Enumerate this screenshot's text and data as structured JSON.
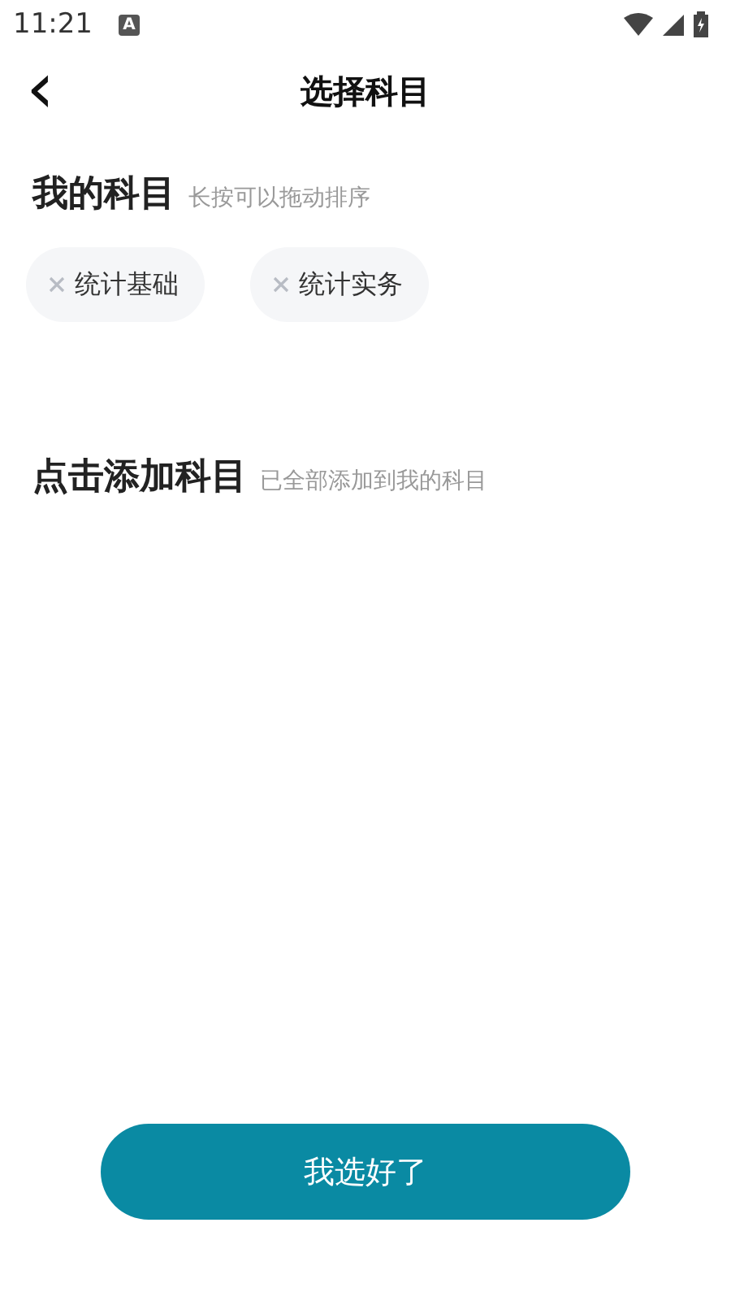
{
  "status_bar": {
    "time": "11:21",
    "notification": "A"
  },
  "header": {
    "back": "‹",
    "title": "选择科目"
  },
  "my_subjects": {
    "title": "我的科目",
    "hint": "长按可以拖动排序",
    "items": [
      {
        "label": "统计基础"
      },
      {
        "label": "统计实务"
      }
    ]
  },
  "add_subjects": {
    "title": "点击添加科目",
    "hint": "已全部添加到我的科目"
  },
  "confirm_button": "我选好了"
}
